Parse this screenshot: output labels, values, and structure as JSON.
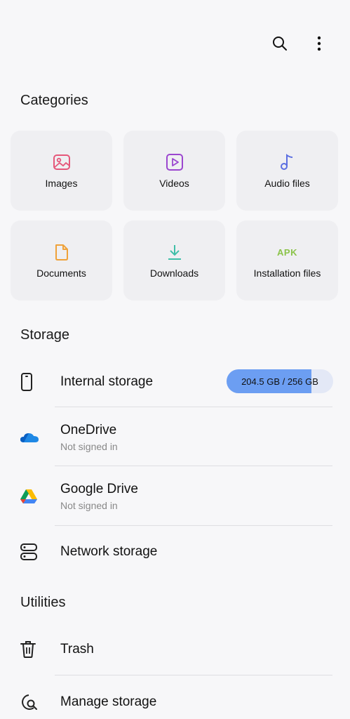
{
  "toolbar": {
    "search_icon": "search-icon",
    "more_icon": "more-vertical-icon"
  },
  "categories": {
    "title": "Categories",
    "items": [
      {
        "label": "Images",
        "icon": "image-icon",
        "color": "#e5577a"
      },
      {
        "label": "Videos",
        "icon": "video-icon",
        "color": "#9b46cf"
      },
      {
        "label": "Audio files",
        "icon": "music-note-icon",
        "color": "#5b6ee1"
      },
      {
        "label": "Documents",
        "icon": "document-icon",
        "color": "#efa23a"
      },
      {
        "label": "Downloads",
        "icon": "download-icon",
        "color": "#3fbfa8"
      },
      {
        "label": "Installation files",
        "icon": "apk-icon",
        "icon_text": "APK",
        "color": "#8bc34a"
      }
    ]
  },
  "storage": {
    "title": "Storage",
    "internal": {
      "label": "Internal storage",
      "usage": "204.5 GB / 256 GB",
      "used_fraction": 0.799
    },
    "onedrive": {
      "label": "OneDrive",
      "status": "Not signed in"
    },
    "gdrive": {
      "label": "Google Drive",
      "status": "Not signed in"
    },
    "network": {
      "label": "Network storage"
    }
  },
  "utilities": {
    "title": "Utilities",
    "trash": {
      "label": "Trash"
    },
    "manage": {
      "label": "Manage storage"
    }
  }
}
